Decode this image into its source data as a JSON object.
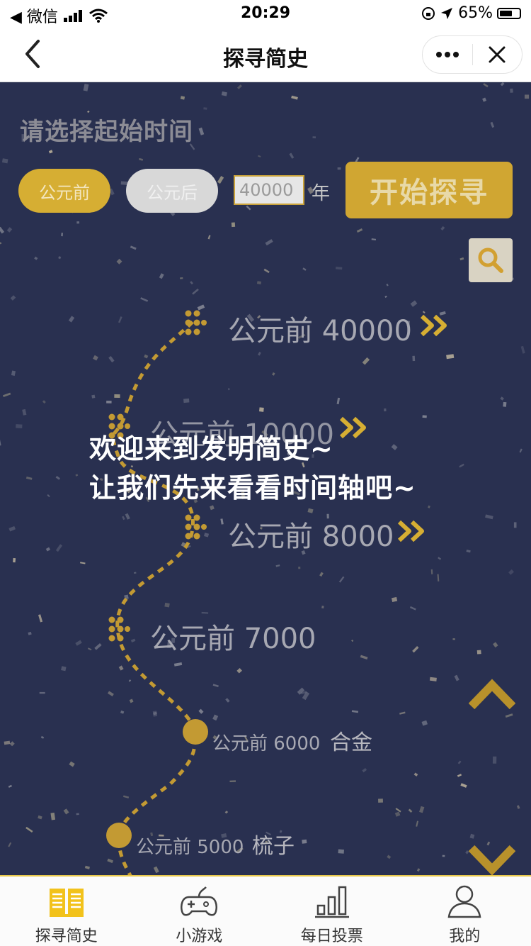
{
  "status_bar": {
    "carrier": "◀ 微信",
    "time": "20:29",
    "battery": "65%",
    "battery_level": 0.65
  },
  "nav": {
    "title": "探寻简史"
  },
  "search_panel": {
    "prompt": "请选择起始时间",
    "bc_label": "公元前",
    "ad_label": "公元后",
    "year_value": "40000",
    "year_unit": "年",
    "start_label": "开始探寻"
  },
  "timeline": {
    "items": [
      {
        "label": "公元前 40000"
      },
      {
        "label": "公元前 10000"
      },
      {
        "label": "公元前 8000"
      },
      {
        "label": "公元前 7000"
      },
      {
        "label": "公元前 6000",
        "name": "合金"
      },
      {
        "label": "公元前 5000",
        "name": "梳子"
      }
    ]
  },
  "welcome": {
    "line1": "欢迎来到发明简史~",
    "line2": "让我们先来看看时间轴吧~"
  },
  "tabs": [
    {
      "label": "探寻简史",
      "icon": "book-icon",
      "active": true
    },
    {
      "label": "小游戏",
      "icon": "gamepad-icon",
      "active": false
    },
    {
      "label": "每日投票",
      "icon": "bar-chart-icon",
      "active": false
    },
    {
      "label": "我的",
      "icon": "user-icon",
      "active": false
    }
  ],
  "colors": {
    "accent": "#d6ae33",
    "background": "#293050",
    "text_dim": "#a7a8b2"
  }
}
